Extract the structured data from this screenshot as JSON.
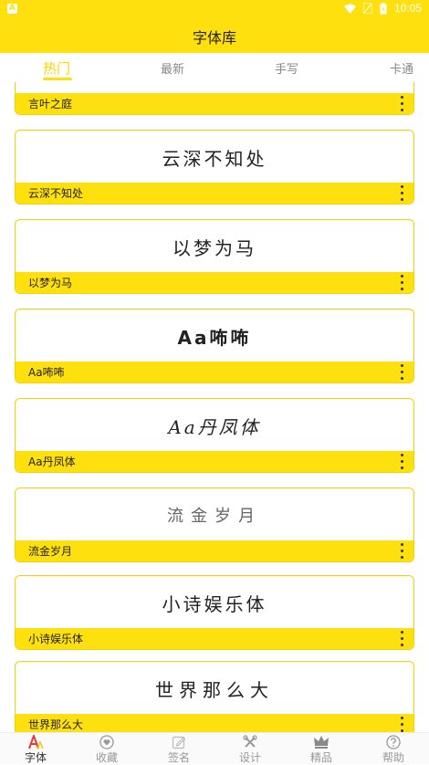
{
  "status_bar": {
    "time": "10:05"
  },
  "header": {
    "title": "字体库"
  },
  "tabs": [
    {
      "label": "热门",
      "active": true
    },
    {
      "label": "最新",
      "active": false
    },
    {
      "label": "手写",
      "active": false
    },
    {
      "label": "卡通",
      "active": false
    }
  ],
  "fonts": [
    {
      "preview": "",
      "name": "言叶之庭"
    },
    {
      "preview": "云深不知处",
      "name": "云深不知处"
    },
    {
      "preview": "以梦为马",
      "name": "以梦为马"
    },
    {
      "preview": "Aa咘咘",
      "name": "Aa咘咘"
    },
    {
      "preview": "Aa丹凤体",
      "name": "Aa丹凤体"
    },
    {
      "preview": "流金岁月",
      "name": "流金岁月"
    },
    {
      "preview": "小诗娱乐体",
      "name": "小诗娱乐体"
    },
    {
      "preview": "世界那么大",
      "name": "世界那么大"
    }
  ],
  "bottom_nav": [
    {
      "label": "字体",
      "icon": "font-icon",
      "active": true
    },
    {
      "label": "收藏",
      "icon": "heart-icon",
      "active": false
    },
    {
      "label": "签名",
      "icon": "pen-icon",
      "active": false
    },
    {
      "label": "设计",
      "icon": "tools-icon",
      "active": false
    },
    {
      "label": "精品",
      "icon": "crown-icon",
      "active": false
    },
    {
      "label": "帮助",
      "icon": "help-icon",
      "active": false
    }
  ],
  "colors": {
    "accent": "#ffe00f",
    "active_tab": "#ffd400"
  }
}
